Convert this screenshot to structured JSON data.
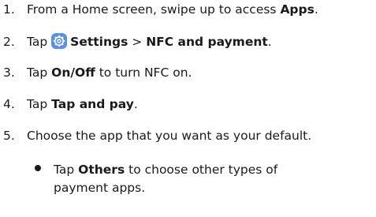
{
  "steps": [
    {
      "num": "1.",
      "pre": "From a Home screen, swipe up to access ",
      "bold": "Apps",
      "post": "."
    },
    {
      "num": "2.",
      "pre": "Tap ",
      "bold1": "Settings",
      "sep": " > ",
      "bold2": "NFC and payment",
      "post": "."
    },
    {
      "num": "3.",
      "pre": "Tap ",
      "bold": "On/Off",
      "post": " to turn NFC on."
    },
    {
      "num": "4.",
      "pre": "Tap ",
      "bold": "Tap and pay",
      "post": "."
    },
    {
      "num": "5.",
      "text": "Choose the app that you want as your default."
    }
  ],
  "bullet": {
    "pre": "Tap ",
    "bold": "Others",
    "post": " to choose other types of",
    "cont": "payment apps."
  },
  "icon": {
    "name": "settings-gear",
    "color": "#5b8fe0"
  }
}
